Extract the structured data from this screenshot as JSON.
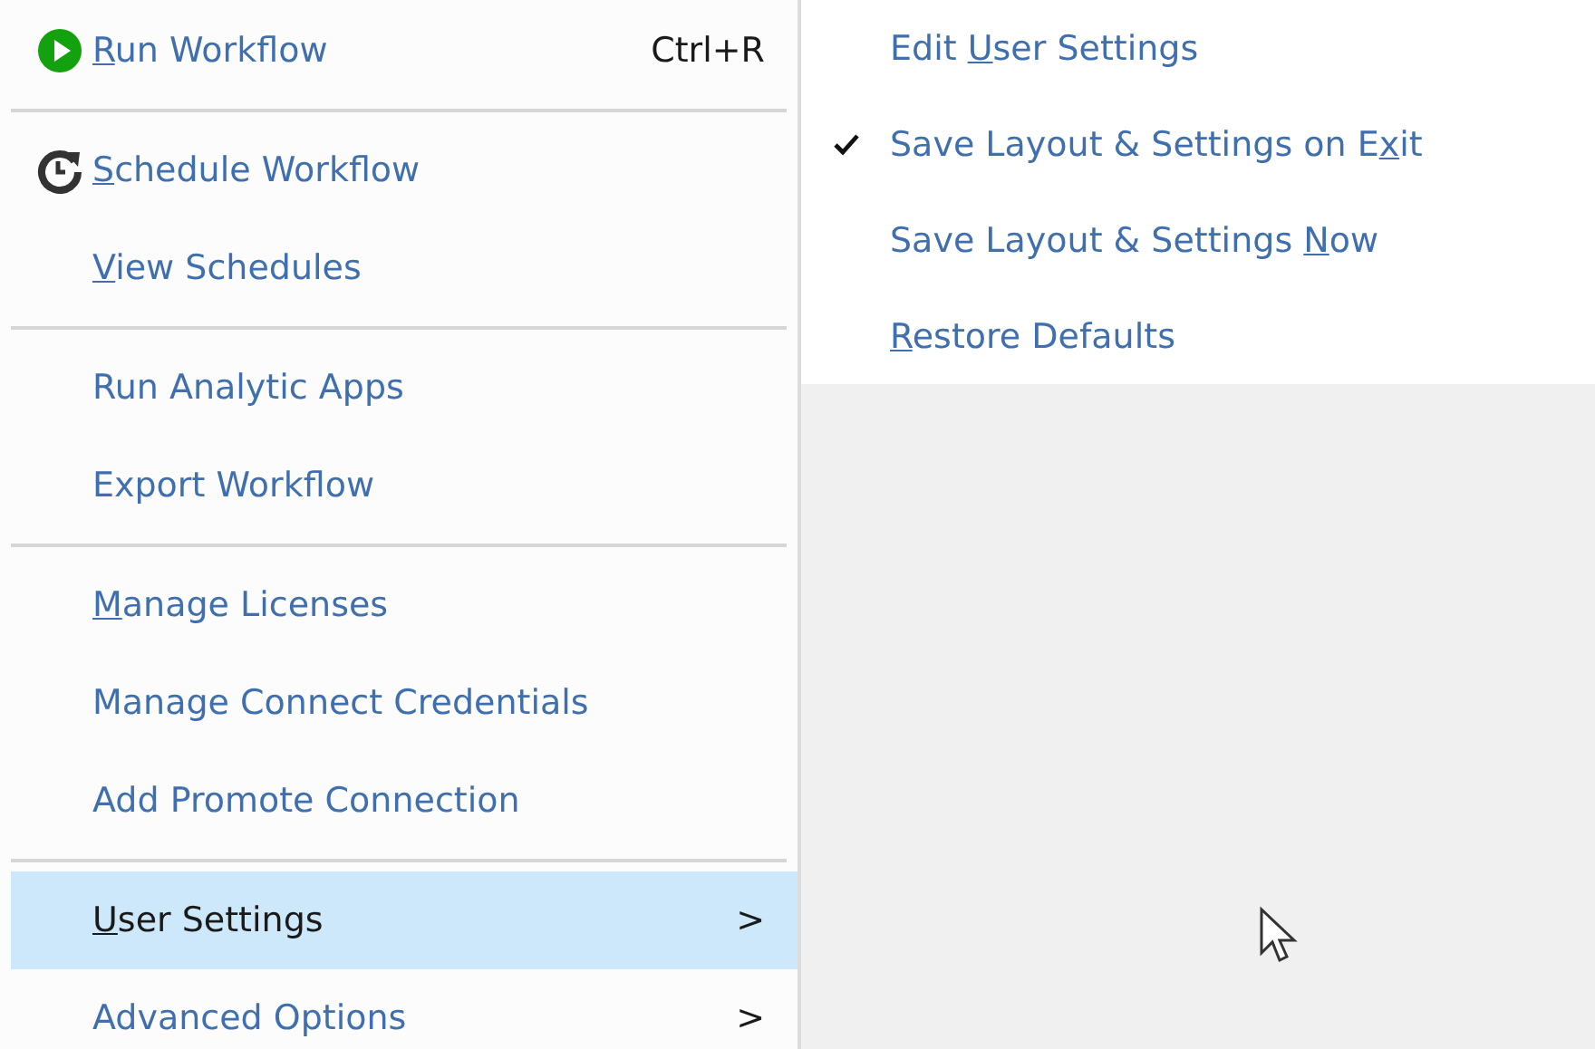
{
  "menu": {
    "groups": [
      {
        "items": [
          {
            "kind": "run",
            "label": {
              "key": "R",
              "post": "un Workflow"
            },
            "shortcut": "Ctrl+R",
            "selected": false
          }
        ]
      },
      {
        "items": [
          {
            "kind": "schedule",
            "label": {
              "key": "S",
              "post": "chedule Workflow"
            },
            "selected": false
          },
          {
            "label": {
              "key": "V",
              "post": "iew Schedules"
            },
            "selected": false
          }
        ]
      },
      {
        "items": [
          {
            "label": {
              "pre": "Run Analytic Apps"
            },
            "selected": false
          },
          {
            "label": {
              "pre": "Export Workflow"
            },
            "selected": false
          }
        ]
      },
      {
        "items": [
          {
            "label": {
              "key": "M",
              "post": "anage Licenses"
            },
            "selected": false
          },
          {
            "label": {
              "pre": "Manage Connect Credentials"
            },
            "selected": false
          },
          {
            "label": {
              "pre": "Add Promote Connection"
            },
            "selected": false
          }
        ]
      },
      {
        "items": [
          {
            "label": {
              "key": "U",
              "post": "ser Settings"
            },
            "submenu": ">",
            "selected": true
          },
          {
            "label": {
              "pre": "Advanced Options"
            },
            "submenu": ">",
            "selected": false
          }
        ]
      }
    ]
  },
  "submenu": {
    "items": [
      {
        "label": {
          "pre": "Edit ",
          "key": "U",
          "post": "ser Settings"
        },
        "checked": false
      },
      {
        "label": {
          "pre": "Save Layout & Settings on E",
          "key": "x",
          "post": "it"
        },
        "checked": true
      },
      {
        "label": {
          "pre": "Save Layout & Settings ",
          "key": "N",
          "post": "ow"
        },
        "checked": false
      },
      {
        "label": {
          "key": "R",
          "post": "estore Defaults"
        },
        "checked": false
      }
    ]
  }
}
